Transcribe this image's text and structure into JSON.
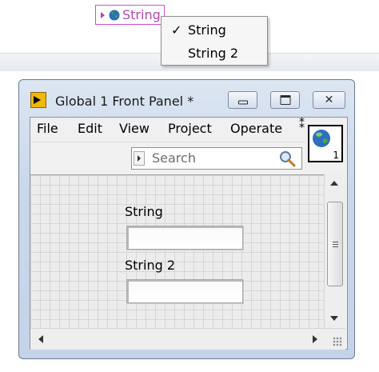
{
  "global_node": {
    "label": "String",
    "arrow_icon": "right-triangle-icon",
    "globe_icon": "globe-icon",
    "border_color": "#d24fd2",
    "text_color": "#b247b2"
  },
  "shortcut_menu": {
    "items": [
      {
        "label": "String",
        "checked": true,
        "check_glyph": "✓"
      },
      {
        "label": "String 2",
        "checked": false,
        "check_glyph": ""
      }
    ]
  },
  "window": {
    "title": "Global 1 Front Panel *",
    "app_icon": "labview-run-icon",
    "buttons": {
      "minimize": "minimize-icon",
      "maximize": "maximize-icon",
      "close": "close-icon",
      "close_glyph": "✕"
    }
  },
  "menubar": {
    "items": [
      "File",
      "Edit",
      "View",
      "Project",
      "Operate"
    ],
    "overflow_glyph": "⁑"
  },
  "toolbar": {
    "search_placeholder": "Search"
  },
  "vi_icon": {
    "number": "1",
    "icon": "globe-icon"
  },
  "panel": {
    "controls": [
      {
        "label": "String",
        "value": ""
      },
      {
        "label": "String 2",
        "value": ""
      }
    ]
  }
}
